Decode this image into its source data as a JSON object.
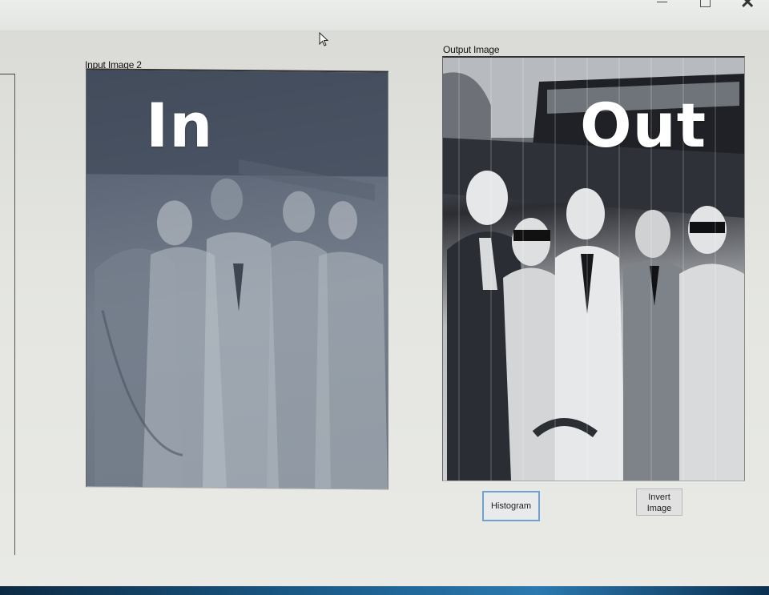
{
  "window": {
    "minimize_label": "",
    "maximize_label": "",
    "close_label": "✕"
  },
  "input_panel": {
    "label": "Input Image 2",
    "overlay_text": "In"
  },
  "output_panel": {
    "label": "Output Image",
    "overlay_text": "Out"
  },
  "buttons": {
    "histogram_label": "Histogram",
    "invert_label_line1": "Invert",
    "invert_label_line2": "Image"
  },
  "icons": {
    "cursor": "arrow-cursor-icon",
    "minimize": "minimize-icon",
    "maximize": "maximize-icon",
    "close": "close-icon"
  },
  "colors": {
    "histogram_border": "#6fa2cf",
    "taskbar": "#1a5a88"
  }
}
